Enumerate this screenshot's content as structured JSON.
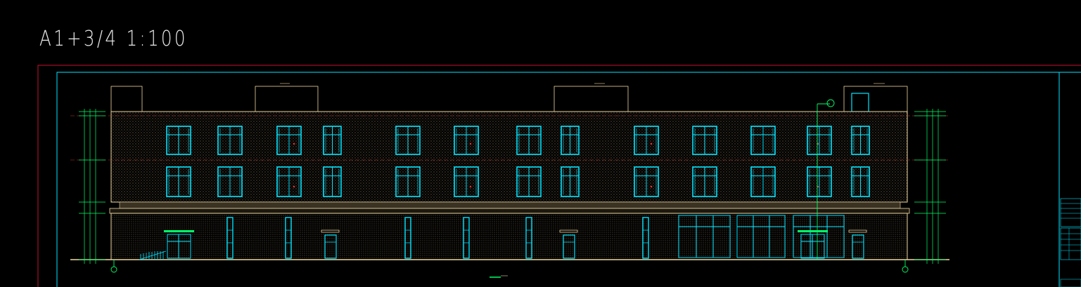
{
  "sheet": {
    "title": "A1+3/4  1:100"
  },
  "colors": {
    "background": "#000000",
    "frame_outer": "#c8102e",
    "frame_inner": "#00e5ff",
    "building_outline": "#f0d8a0",
    "window": "#00e5ff",
    "dimension": "#00ff66",
    "centerline": "#c03a2b",
    "wall_fill": "#7a6a52"
  },
  "elevation": {
    "drawing_name_icon": "elevation-title-marker",
    "grid_axis_icon": "grid-axis-bubble"
  }
}
